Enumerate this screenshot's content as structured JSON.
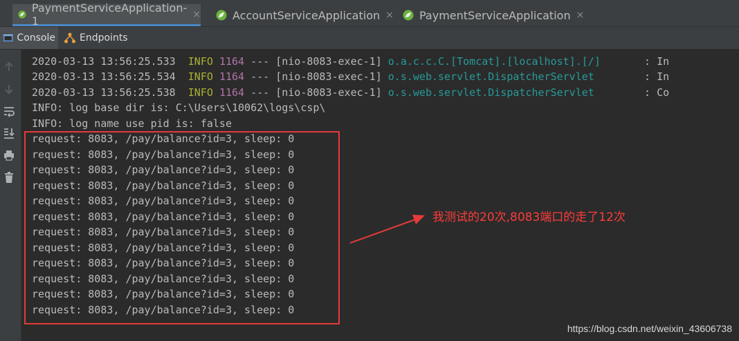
{
  "tabs": [
    {
      "label": "PaymentServiceApplication-1",
      "close": "×",
      "active": true
    },
    {
      "label": "AccountServiceApplication",
      "close": "×",
      "active": false
    },
    {
      "label": "PaymentServiceApplication",
      "close": "×",
      "active": false
    }
  ],
  "toolbar": {
    "console_label": "Console",
    "endpoints_label": "Endpoints"
  },
  "log_lines": [
    {
      "ts": "2020-03-13 13:56:25.533",
      "level": "INFO",
      "pid": "1164",
      "sep": " --- ",
      "thread": "[nio-8083-exec-1] ",
      "logger": "o.a.c.c.C.[Tomcat].[localhost].[/]",
      "tail": "       : In"
    },
    {
      "ts": "2020-03-13 13:56:25.534",
      "level": "INFO",
      "pid": "1164",
      "sep": " --- ",
      "thread": "[nio-8083-exec-1] ",
      "logger": "o.s.web.servlet.DispatcherServlet",
      "tail": "        : In"
    },
    {
      "ts": "2020-03-13 13:56:25.538",
      "level": "INFO",
      "pid": "1164",
      "sep": " --- ",
      "thread": "[nio-8083-exec-1] ",
      "logger": "o.s.web.servlet.DispatcherServlet",
      "tail": "        : Co"
    }
  ],
  "plain_lines": [
    "INFO: log base dir is: C:\\Users\\10062\\logs\\csp\\",
    "INFO: log name use pid is: false"
  ],
  "request_lines": [
    "request: 8083, /pay/balance?id=3, sleep: 0",
    "request: 8083, /pay/balance?id=3, sleep: 0",
    "request: 8083, /pay/balance?id=3, sleep: 0",
    "request: 8083, /pay/balance?id=3, sleep: 0",
    "request: 8083, /pay/balance?id=3, sleep: 0",
    "request: 8083, /pay/balance?id=3, sleep: 0",
    "request: 8083, /pay/balance?id=3, sleep: 0",
    "request: 8083, /pay/balance?id=3, sleep: 0",
    "request: 8083, /pay/balance?id=3, sleep: 0",
    "request: 8083, /pay/balance?id=3, sleep: 0",
    "request: 8083, /pay/balance?id=3, sleep: 0",
    "request: 8083, /pay/balance?id=3, sleep: 0"
  ],
  "annotation": "我测试的20次,8083端口的走了12次",
  "watermark": "https://blog.csdn.net/weixin_43606738",
  "gutter_icons": [
    "up-arrow-icon",
    "down-arrow-icon",
    "soft-wrap-icon",
    "scroll-to-end-icon",
    "print-icon",
    "trash-icon"
  ],
  "colors": {
    "accent": "#4a88c7",
    "annotation": "#ff3b3b",
    "info": "#a9b232",
    "pid": "#b074a5",
    "logger": "#299999"
  }
}
